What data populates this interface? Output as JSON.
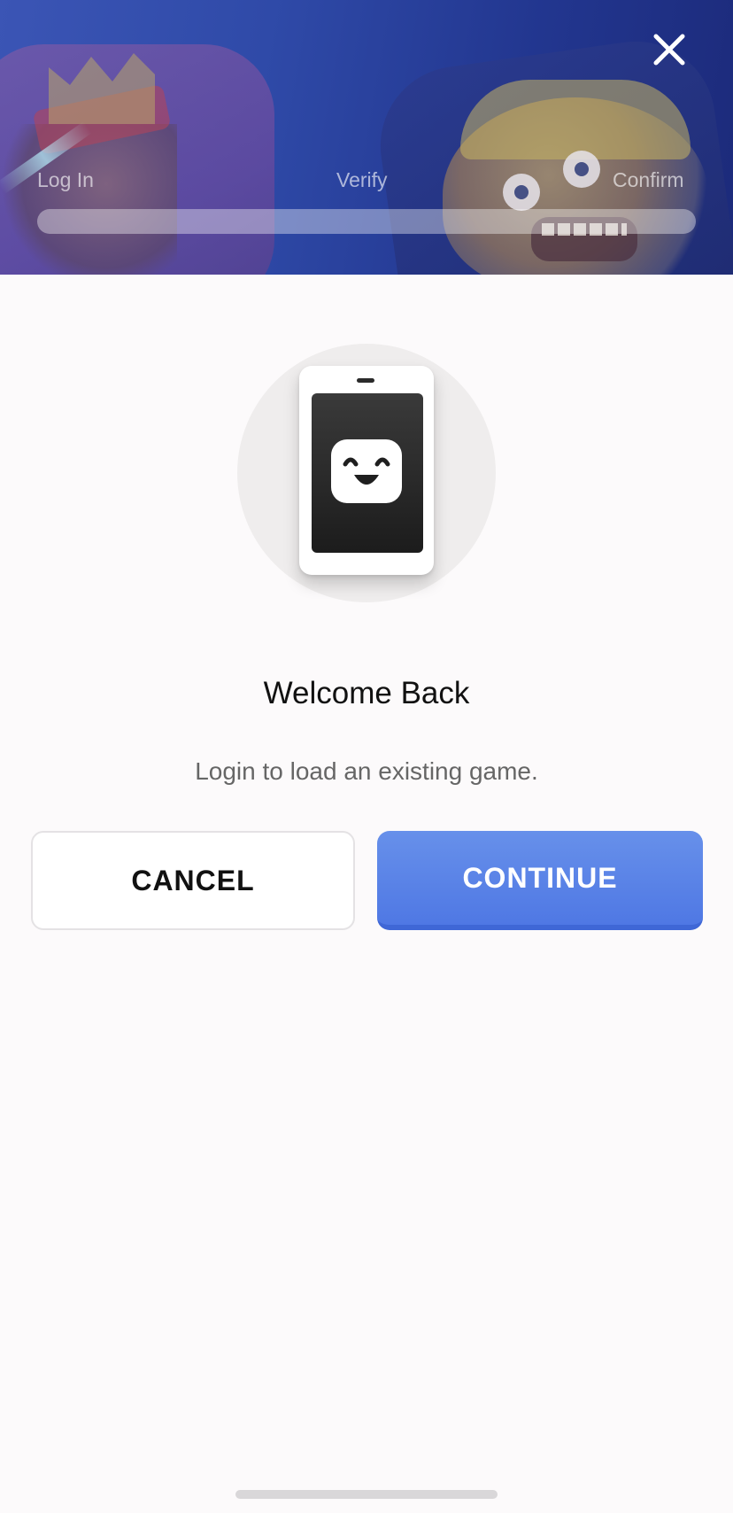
{
  "header": {
    "steps": [
      {
        "label": "Log In"
      },
      {
        "label": "Verify"
      },
      {
        "label": "Confirm"
      }
    ],
    "progress": 0,
    "close_icon": "close-icon"
  },
  "illustration": {
    "icon": "phone-smiley-icon"
  },
  "content": {
    "title": "Welcome Back",
    "subtitle": "Login to load an existing game."
  },
  "actions": {
    "cancel_label": "CANCEL",
    "continue_label": "CONTINUE"
  },
  "colors": {
    "accent": "#5a82e6",
    "header_blue": "#2f4aa8",
    "background": "#fcfafb"
  }
}
